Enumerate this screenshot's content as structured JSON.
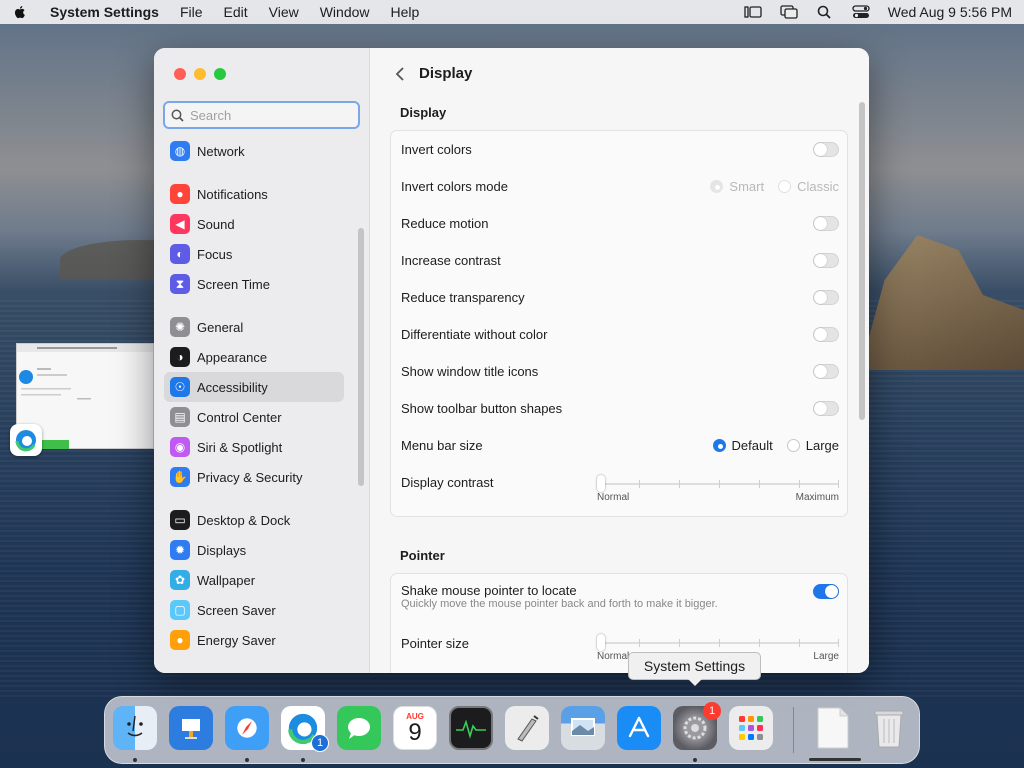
{
  "menubar": {
    "app_name": "System Settings",
    "menus": [
      "File",
      "Edit",
      "View",
      "Window",
      "Help"
    ],
    "datetime": "Wed Aug 9  5:56 PM"
  },
  "sidebar": {
    "search_placeholder": "Search",
    "groups": [
      [
        {
          "label": "Network",
          "icon": "globe-icon",
          "color": "#2f7bf2"
        }
      ],
      [
        {
          "label": "Notifications",
          "icon": "bell-icon",
          "color": "#ff453a"
        },
        {
          "label": "Sound",
          "icon": "speaker-icon",
          "color": "#ff375f"
        },
        {
          "label": "Focus",
          "icon": "moon-icon",
          "color": "#5e5ce6"
        },
        {
          "label": "Screen Time",
          "icon": "hourglass-icon",
          "color": "#5e5ce6"
        }
      ],
      [
        {
          "label": "General",
          "icon": "gear-icon",
          "color": "#8e8e93"
        },
        {
          "label": "Appearance",
          "icon": "appearance-icon",
          "color": "#1c1c1e"
        },
        {
          "label": "Accessibility",
          "icon": "accessibility-icon",
          "color": "#1f78ea",
          "active": true
        },
        {
          "label": "Control Center",
          "icon": "control-center-icon",
          "color": "#8e8e93"
        },
        {
          "label": "Siri & Spotlight",
          "icon": "siri-icon",
          "color": "#bf5af2"
        },
        {
          "label": "Privacy & Security",
          "icon": "hand-icon",
          "color": "#2f7bf2"
        }
      ],
      [
        {
          "label": "Desktop & Dock",
          "icon": "dock-icon",
          "color": "#1c1c1e"
        },
        {
          "label": "Displays",
          "icon": "sun-icon",
          "color": "#2f7bf2"
        },
        {
          "label": "Wallpaper",
          "icon": "flower-icon",
          "color": "#32ade6"
        },
        {
          "label": "Screen Saver",
          "icon": "screen-saver-icon",
          "color": "#5ac8fa"
        },
        {
          "label": "Energy Saver",
          "icon": "bulb-icon",
          "color": "#ff9f0a"
        }
      ]
    ]
  },
  "content": {
    "title": "Display",
    "display_section": {
      "title": "Display",
      "invert_colors": "Invert colors",
      "invert_colors_mode": "Invert colors mode",
      "mode_smart": "Smart",
      "mode_classic": "Classic",
      "reduce_motion": "Reduce motion",
      "increase_contrast": "Increase contrast",
      "reduce_transparency": "Reduce transparency",
      "differentiate": "Differentiate without color",
      "window_title_icons": "Show window title icons",
      "toolbar_shapes": "Show toolbar button shapes",
      "menu_bar_size": "Menu bar size",
      "menu_default": "Default",
      "menu_large": "Large",
      "display_contrast": "Display contrast",
      "contrast_min": "Normal",
      "contrast_max": "Maximum"
    },
    "pointer_section": {
      "title": "Pointer",
      "shake": "Shake mouse pointer to locate",
      "shake_desc": "Quickly move the mouse pointer back and forth to make it bigger.",
      "pointer_size": "Pointer size",
      "size_min": "Normal",
      "size_max": "Large"
    }
  },
  "dock": {
    "tooltip": "System Settings",
    "calendar_month": "AUG",
    "calendar_day": "9",
    "edge_badge": "1",
    "settings_badge": "1"
  }
}
